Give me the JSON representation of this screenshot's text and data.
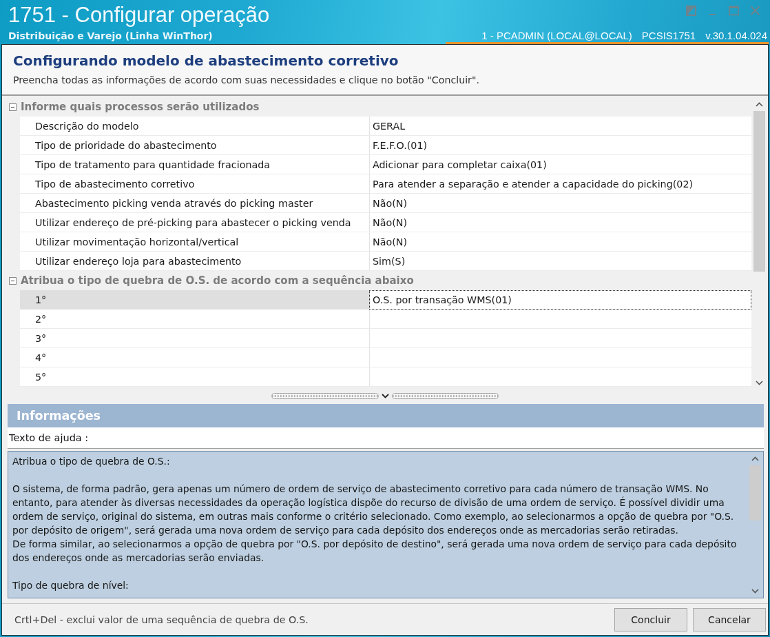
{
  "window": {
    "title": "1751 - Configurar operação",
    "subtitle": "Distribuição e Varejo (Linha WinThor)",
    "session": "1 - PCADMIN (LOCAL@LOCAL)",
    "program": "PCSIS1751",
    "version": "v.30.1.04.024"
  },
  "header": {
    "title": "Configurando modelo de abastecimento corretivo",
    "instructions": "Preencha todas as informações de acordo com suas necessidades e clique no botão \"Concluir\"."
  },
  "grid": {
    "groups": [
      {
        "title": "Informe quais processos serão utilizados",
        "expanded": true,
        "rows": [
          {
            "label": "Descrição do modelo",
            "value": "GERAL",
            "selected": false
          },
          {
            "label": "Tipo de prioridade do abastecimento",
            "value": "F.E.F.O.(01)",
            "selected": false
          },
          {
            "label": "Tipo de tratamento para quantidade fracionada",
            "value": "Adicionar para completar caixa(01)",
            "selected": false
          },
          {
            "label": "Tipo de abastecimento corretivo",
            "value": "Para atender a separação e atender a capacidade do picking(02)",
            "selected": false
          },
          {
            "label": "Abastecimento picking venda através do picking master",
            "value": "Não(N)",
            "selected": false
          },
          {
            "label": "Utilizar endereço de pré-picking para abastecer o picking venda",
            "value": "Não(N)",
            "selected": false
          },
          {
            "label": "Utilizar movimentação horizontal/vertical",
            "value": "Não(N)",
            "selected": false
          },
          {
            "label": "Utilizar endereço loja para abastecimento",
            "value": "Sim(S)",
            "selected": false
          }
        ]
      },
      {
        "title": "Atribua o tipo de quebra de O.S. de acordo com a sequência abaixo",
        "expanded": true,
        "rows": [
          {
            "label": "1°",
            "value": "O.S. por transação WMS(01)",
            "selected": true
          },
          {
            "label": "2°",
            "selected": false
          },
          {
            "label": "3°",
            "selected": false
          },
          {
            "label": "4°",
            "selected": false
          },
          {
            "label": "5°",
            "selected": false
          }
        ]
      }
    ]
  },
  "info_panel": {
    "title": "Informações",
    "help_label": "Texto de ajuda :",
    "help_text": [
      [
        "Atribua o tipo de quebra de O.S.:"
      ],
      [
        "O sistema, de forma padrão, gera apenas um número de ordem de serviço de abastecimento corretivo para cada número de transação WMS. No entanto, para atender às diversas necessidades da operação logística dispõe do recurso de divisão de uma ordem de serviço. É possível dividir uma ordem de serviço, original do sistema, em outras mais conforme o critério selecionado. Como exemplo, ao selecionarmos a opção de quebra por \"O.S. por depósito de origem\", será gerada uma nova ordem de serviço para cada depósito dos endereços onde as mercadorias serão retiradas.",
        "De forma similar, ao selecionarmos a opção de quebra por \"O.S. por depósito de destino\", será gerada uma nova ordem de serviço para cada depósito dos endereços onde as mercadorias serão enviadas."
      ],
      [
        "Tipo de quebra de nível:"
      ]
    ]
  },
  "status_bar": {
    "hint": "Crtl+Del - exclui valor de uma sequência de quebra de O.S.",
    "buttons": [
      {
        "label": "Concluir",
        "kind": "confirm"
      },
      {
        "label": "Cancelar",
        "kind": "cancel"
      }
    ]
  }
}
